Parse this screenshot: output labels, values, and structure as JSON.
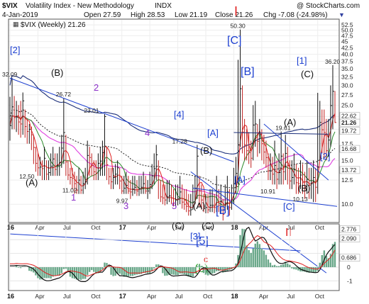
{
  "header": {
    "symbol": "$VIX",
    "name": "Volatility Index - New Methodology",
    "exchange": "INDX",
    "date": "4-Jan-2019",
    "open": "Open 27.59",
    "high": "High 28.53",
    "low": "Low 21.19",
    "close": "Close 21.26",
    "chg": "Chg -7.08 (-24.98%)",
    "copyright": "@ StockCharts.com",
    "legend": "$VIX (Weekly) 21.26"
  },
  "chart_data": {
    "type": "line",
    "title": "$VIX (Weekly) 21.26",
    "scale": "log",
    "ylim": [
      8.5,
      55
    ],
    "y_ticks": [
      10.0,
      12.5,
      15.0,
      17.5,
      20.0,
      22.5,
      25.0,
      27.5,
      30.0,
      32.5,
      35.0,
      37.5,
      40.0,
      42.5,
      45.0,
      47.5,
      50.0,
      52.5
    ],
    "y_tick_labels": [
      "10.0",
      "12.5",
      "15.0",
      "17.5",
      "20.0",
      "22.5",
      "25.0",
      "27.5",
      "30.0",
      "32.5",
      "35.0",
      "37.5",
      "40.0",
      "42.5",
      "45",
      "47.5",
      "50.0",
      "52.5"
    ],
    "x_tick_labels": [
      "16",
      "Apr",
      "Jul",
      "Oct",
      "17",
      "Apr",
      "Jul",
      "Oct",
      "18",
      "Apr",
      "Jul",
      "Oct"
    ],
    "x_tick_bold": [
      true,
      false,
      false,
      false,
      true,
      false,
      false,
      false,
      true,
      false,
      false,
      false
    ],
    "x_tick_weeks": [
      0,
      13,
      26,
      39,
      52,
      65,
      78,
      91,
      104,
      117,
      130,
      143
    ],
    "close": [
      20.7,
      24.6,
      22.3,
      22.4,
      21.4,
      21.0,
      26.0,
      20.5,
      19.6,
      20.0,
      19.0,
      16.9,
      14.6,
      14.0,
      14.1,
      13.9,
      15.3,
      13.2,
      13.4,
      14.2,
      15.2,
      13.8,
      14.3,
      14.7,
      16.8,
      19.4,
      14.8,
      13.1,
      12.8,
      12.7,
      12.1,
      11.4,
      12.5,
      11.4,
      12.1,
      12.3,
      15.7,
      15.4,
      14.3,
      13.5,
      13.3,
      14.6,
      14.9,
      16.1,
      22.5,
      14.4,
      12.9,
      12.3,
      12.8,
      13.2,
      14.0,
      12.4,
      11.3,
      11.6,
      11.9,
      11.3,
      11.2,
      11.5,
      11.7,
      11.3,
      11.5,
      11.7,
      12.1,
      11.3,
      11.3,
      12.0,
      13.0,
      13.9,
      15.8,
      13.0,
      10.7,
      10.6,
      10.4,
      10.7,
      10.8,
      10.6,
      10.1,
      10.4,
      10.5,
      11.2,
      10.2,
      10.0,
      9.8,
      9.4,
      9.5,
      10.2,
      11.6,
      15.6,
      11.3,
      10.4,
      9.6,
      9.7,
      9.5,
      9.9,
      9.9,
      9.7,
      11.2,
      9.9,
      10.3,
      9.1,
      10.1,
      11.2,
      9.7,
      10.4,
      12.1,
      13.3,
      17.3,
      29.1,
      19.5,
      17.3,
      16.4,
      16.1,
      15.3,
      20.8,
      21.0,
      17.9,
      19.0,
      17.5,
      16.2,
      15.4,
      13.6,
      13.6,
      13.2,
      14.3,
      12.6,
      13.4,
      15.6,
      13.5,
      16.0,
      14.3,
      12.4,
      12.8,
      13.8,
      12.2,
      12.1,
      13.1,
      12.2,
      11.6,
      12.6,
      11.9,
      12.1,
      12.8,
      11.7,
      14.1,
      21.3,
      19.9,
      19.4,
      16.4,
      18.1,
      24.9,
      28.4,
      21.3
    ],
    "high": [
      27.0,
      32.1,
      27.2,
      26.0,
      25.0,
      26.0,
      28.1,
      24.0,
      22.0,
      21.0,
      20.5,
      19.0,
      17.0,
      16.0,
      15.5,
      15.0,
      17.0,
      15.0,
      15.0,
      16.0,
      17.0,
      16.0,
      16.0,
      17.0,
      19.0,
      26.7,
      19.0,
      15.0,
      14.0,
      14.0,
      13.5,
      13.0,
      14.0,
      13.0,
      13.5,
      14.0,
      18.0,
      17.0,
      16.0,
      15.0,
      15.0,
      16.0,
      17.0,
      18.0,
      23.0,
      17.0,
      14.0,
      14.0,
      14.0,
      14.5,
      15.0,
      14.0,
      13.0,
      13.0,
      13.5,
      13.0,
      12.5,
      13.0,
      13.0,
      12.5,
      13.0,
      13.0,
      13.5,
      13.0,
      12.5,
      13.5,
      14.5,
      16.0,
      17.3,
      15.0,
      12.5,
      12.0,
      12.0,
      12.5,
      12.5,
      12.0,
      11.5,
      12.0,
      12.0,
      13.0,
      12.0,
      11.5,
      11.5,
      11.0,
      11.0,
      12.0,
      13.0,
      17.3,
      13.0,
      12.0,
      11.0,
      11.0,
      11.0,
      11.5,
      11.5,
      11.0,
      13.0,
      11.5,
      12.0,
      10.5,
      12.0,
      13.0,
      11.5,
      12.0,
      14.0,
      15.5,
      38.0,
      50.3,
      30.0,
      22.0,
      20.0,
      19.5,
      18.0,
      25.0,
      26.0,
      21.0,
      22.0,
      20.0,
      19.0,
      18.0,
      16.0,
      16.0,
      15.5,
      18.0,
      15.0,
      16.0,
      19.6,
      16.0,
      19.0,
      17.0,
      15.0,
      15.0,
      16.0,
      14.5,
      14.0,
      15.0,
      14.5,
      13.5,
      15.0,
      14.0,
      14.0,
      15.0,
      14.0,
      28.0,
      26.0,
      24.0,
      24.0,
      22.0,
      22.0,
      30.0,
      36.2,
      28.5
    ],
    "low": [
      18.0,
      20.0,
      20.0,
      19.5,
      19.0,
      18.5,
      19.0,
      18.5,
      17.5,
      17.5,
      16.5,
      14.5,
      13.5,
      13.0,
      13.0,
      12.5,
      12.5,
      12.5,
      12.5,
      13.0,
      13.0,
      13.0,
      13.0,
      13.0,
      14.0,
      14.5,
      13.0,
      12.5,
      12.0,
      11.5,
      11.0,
      11.0,
      11.0,
      11.0,
      11.0,
      11.5,
      12.0,
      13.0,
      13.0,
      12.5,
      12.5,
      12.5,
      13.0,
      13.0,
      13.0,
      12.5,
      12.0,
      11.5,
      11.5,
      12.0,
      12.0,
      11.5,
      11.0,
      11.0,
      11.0,
      11.0,
      10.5,
      10.8,
      11.0,
      10.8,
      10.8,
      11.0,
      11.0,
      11.0,
      10.5,
      11.0,
      11.5,
      12.0,
      12.5,
      10.5,
      10.2,
      10.0,
      9.9,
      10.0,
      10.2,
      10.0,
      9.8,
      9.8,
      9.9,
      10.0,
      9.6,
      9.5,
      9.3,
      9.0,
      9.0,
      9.5,
      10.0,
      10.5,
      9.8,
      9.5,
      9.3,
      9.2,
      9.2,
      9.3,
      9.3,
      9.2,
      9.3,
      9.3,
      9.2,
      8.6,
      9.2,
      9.5,
      9.0,
      9.5,
      10.0,
      11.0,
      12.0,
      17.0,
      16.0,
      15.0,
      15.0,
      14.5,
      14.0,
      15.0,
      17.0,
      15.5,
      16.0,
      15.0,
      14.5,
      14.0,
      12.5,
      12.5,
      12.0,
      12.0,
      11.5,
      12.0,
      12.0,
      12.0,
      12.5,
      12.0,
      11.5,
      11.5,
      12.0,
      11.0,
      11.0,
      11.5,
      11.0,
      10.5,
      11.0,
      10.5,
      10.5,
      10.2,
      10.2,
      11.0,
      15.0,
      16.0,
      15.5,
      15.0,
      15.5,
      17.0,
      20.0,
      21.2
    ],
    "line_labels": [
      {
        "text": "32.09",
        "x": 0,
        "y": 32.09
      },
      {
        "text": "26.72",
        "x": 25,
        "y": 26.72
      },
      {
        "text": "23.01",
        "x": 38,
        "y": 23.01
      },
      {
        "text": "12.50",
        "x": 8,
        "y": 12.5
      },
      {
        "text": "11.02",
        "x": 28,
        "y": 11.02
      },
      {
        "text": "9.97",
        "x": 53,
        "y": 9.97
      },
      {
        "text": "17.28",
        "x": 79,
        "y": 17.28
      },
      {
        "text": "50.30",
        "x": 106,
        "y": 50.3
      },
      {
        "text": "19.61",
        "x": 127,
        "y": 19.61
      },
      {
        "text": "10.91",
        "x": 120,
        "y": 10.91
      },
      {
        "text": "10.13",
        "x": 135,
        "y": 10.13
      },
      {
        "text": "36.20",
        "x": 150,
        "y": 36.2
      }
    ],
    "price_labels": [
      "22.62",
      "21.26",
      "19.72",
      "16.68",
      "13.72"
    ],
    "lower_panel_labels": [
      "2.776",
      "2.090",
      "0.686",
      "0",
      "-1"
    ],
    "lower_panel_ticks": [
      -1,
      0,
      1,
      2
    ]
  },
  "annotations": [
    {
      "text": "[2]",
      "color": "#1c3fd0"
    },
    {
      "text": "(B)",
      "color": "#111"
    },
    {
      "text": "2",
      "color": "#8b2fc9"
    },
    {
      "text": "(A)",
      "color": "#111"
    },
    {
      "text": "1",
      "color": "#8b2fc9"
    },
    {
      "text": "4",
      "color": "#8b2fc9"
    },
    {
      "text": "[4]",
      "color": "#1c3fd0"
    },
    {
      "text": "3",
      "color": "#8b2fc9"
    },
    {
      "text": "5",
      "color": "#8b2fc9"
    },
    {
      "text": "(A)",
      "color": "#111"
    },
    {
      "text": "(B)",
      "color": "#111"
    },
    {
      "text": "[A]",
      "color": "#1c3fd0"
    },
    {
      "text": "[A]",
      "color": "#1c3fd0"
    },
    {
      "text": "[C]",
      "color": "#1c3fd0"
    },
    {
      "text": "I",
      "color": "#e02020"
    },
    {
      "text": "[B]",
      "color": "#1c3fd0"
    },
    {
      "text": "(A)",
      "color": "#111"
    },
    {
      "text": "[1]",
      "color": "#1c3fd0"
    },
    {
      "text": "(C)",
      "color": "#111"
    },
    {
      "text": "[2]",
      "color": "#1c3fd0"
    },
    {
      "text": "(B)",
      "color": "#111"
    },
    {
      "text": "[C]",
      "color": "#1c3fd0"
    },
    {
      "text": "[B]",
      "color": "#1c3fd0"
    },
    {
      "text": "(C)",
      "color": "#111"
    },
    {
      "text": "[3]",
      "color": "#1c3fd0"
    },
    {
      "text": "(C)",
      "color": "#111"
    },
    {
      "text": "[5]",
      "color": "#1c3fd0"
    },
    {
      "text": "II",
      "color": "#e02020"
    },
    {
      "text": "c",
      "color": "#e02020"
    },
    {
      "text": "(b)",
      "color": "#1a9a1a"
    }
  ],
  "colors": {
    "price_bar": "#c02020",
    "ma_long": "#1c2f7a",
    "ma_mid": "#e040e0",
    "ma_short_red": "#e02020",
    "ma_short_green": "#2a8a2a",
    "trend_blue": "#1c3fd0",
    "lower_hist": "#6aa88a"
  }
}
